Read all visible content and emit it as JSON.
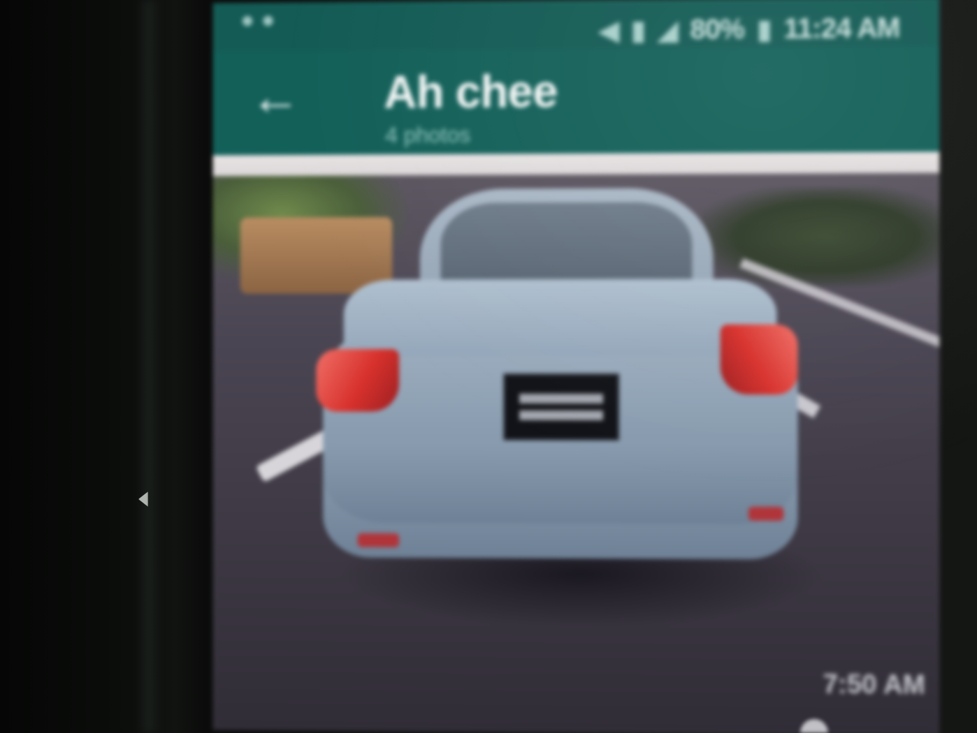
{
  "status_bar": {
    "battery": "80%",
    "time": "11:24 AM"
  },
  "app_bar": {
    "title": "Ah chee",
    "subtitle": "4 photos"
  },
  "photo": {
    "timestamp": "7:50 AM"
  },
  "icons": {
    "back": "arrow-left-icon",
    "signal": "signal-icon",
    "battery": "battery-icon",
    "sim": "sim-icon",
    "mute": "mute-icon"
  },
  "colors": {
    "app_bar": "#136059",
    "status_bar": "#145b55"
  }
}
